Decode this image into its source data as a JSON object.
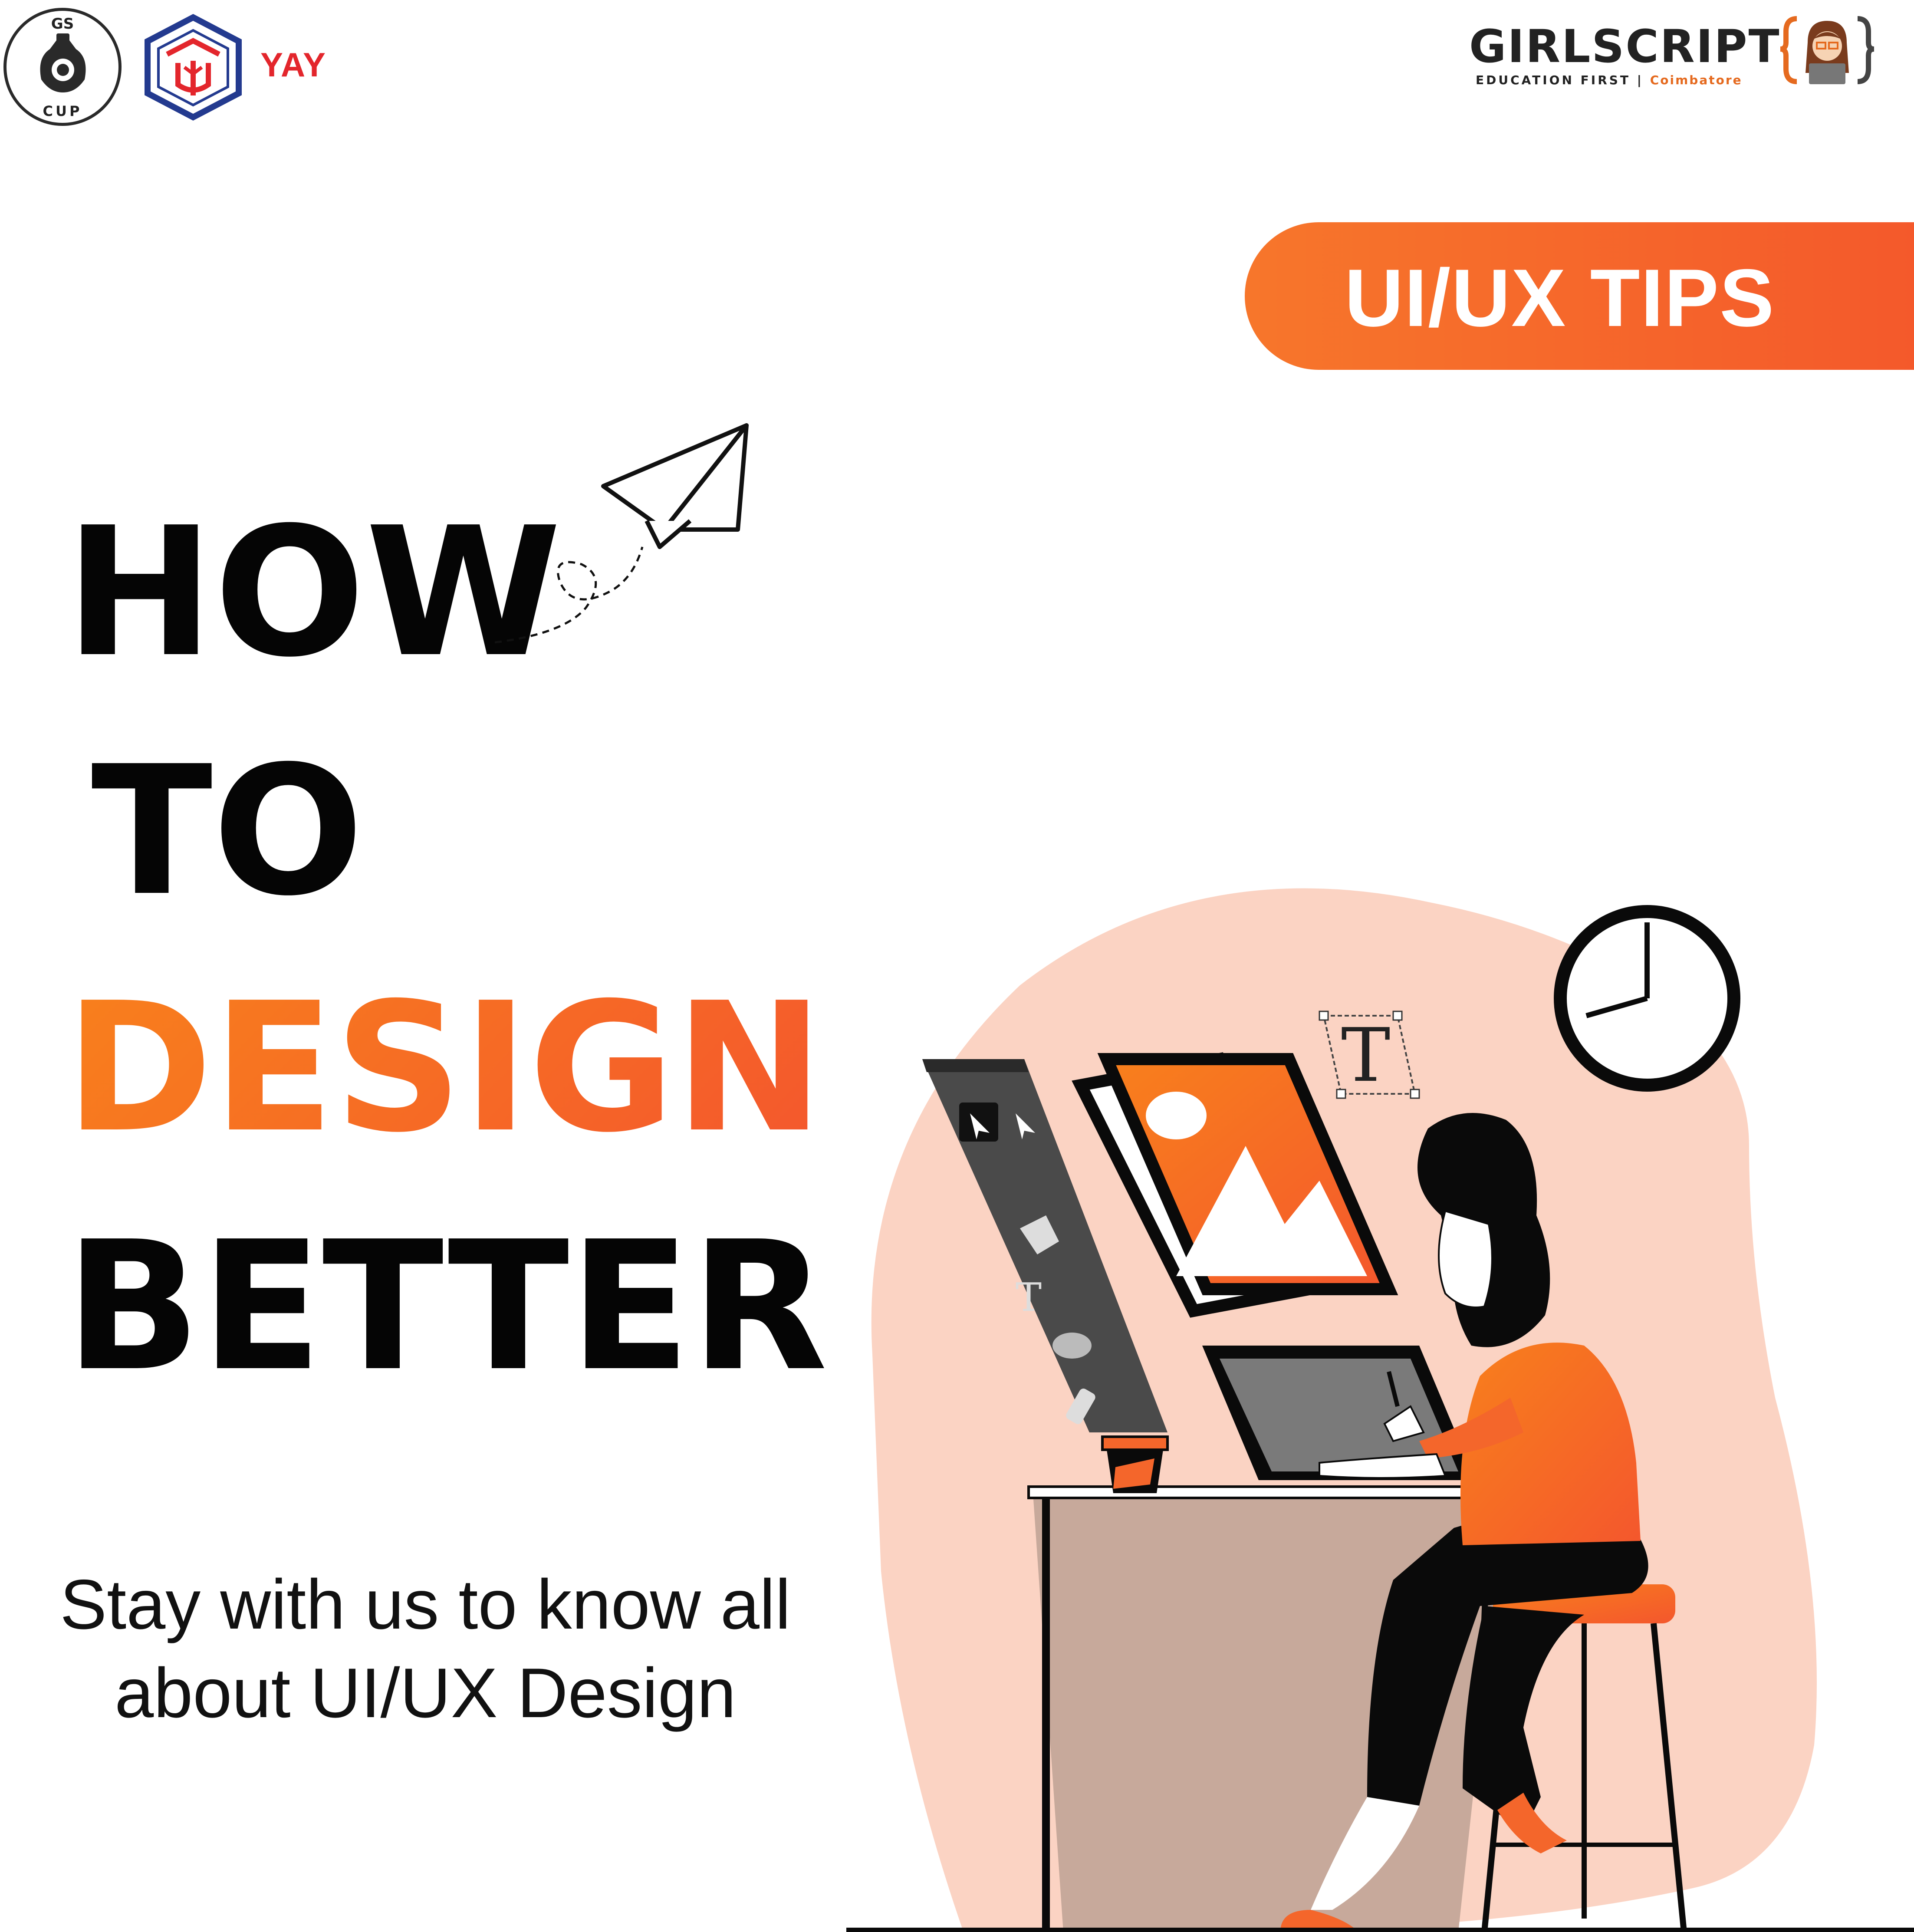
{
  "logos": {
    "gs_cup": {
      "top_text": "GS",
      "bottom_text": "CUP"
    },
    "yay": {
      "text": "YAY",
      "color": "#e3262c"
    },
    "girlscript": {
      "name": "GIRLSCRIPT",
      "tagline": "EDUCATION FIRST |",
      "city": "Coimbatore"
    }
  },
  "badge": {
    "label": "UI/UX TIPS"
  },
  "headline": {
    "line1": "HOW",
    "line2": "TO",
    "line3": "DESIGN",
    "line4": "BETTER"
  },
  "subtitle": {
    "line1": "Stay with us to know all",
    "line2": "about UI/UX Design"
  },
  "colors": {
    "accent": "#f4662b",
    "accent_light": "#f8801c",
    "text_dark": "#050505",
    "blob": "#fbd3c3",
    "yay_red": "#e3262c",
    "yay_blue": "#233a8f"
  },
  "icons": [
    "paper-plane-icon",
    "clock-icon",
    "image-icon",
    "text-tool-icon",
    "cursor-icon",
    "pen-tool-icon",
    "brush-icon"
  ]
}
